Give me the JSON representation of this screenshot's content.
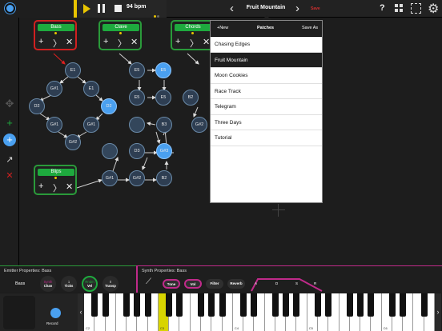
{
  "toolbar": {
    "bpm": "94 bpm",
    "patch_title": "Fruit Mountain",
    "save_label": "Save",
    "help_label": "?"
  },
  "emitters": [
    {
      "label": "Bass",
      "color": "#1eaa3e",
      "border": "#d02020"
    },
    {
      "label": "Clave",
      "color": "#1eaa3e",
      "border": "#2a9a3a"
    },
    {
      "label": "Chords",
      "color": "#1eaa3e",
      "border": "#2a9a3a"
    },
    {
      "label": "Blips",
      "color": "#1eaa3e",
      "border": "#2a9a3a"
    }
  ],
  "emitter_controls": {
    "add": "+",
    "next": "〉",
    "remove": "✕"
  },
  "nodes": [
    {
      "label": "E1"
    },
    {
      "label": "G#1"
    },
    {
      "label": "E1"
    },
    {
      "label": "D2"
    },
    {
      "label": "D2"
    },
    {
      "label": "G#1"
    },
    {
      "label": "G#1"
    },
    {
      "label": "G#2"
    },
    {
      "label": "E5"
    },
    {
      "label": "E5"
    },
    {
      "label": "E5"
    },
    {
      "label": "E5"
    },
    {
      "label": "B2"
    },
    {
      "label": "G#2"
    },
    {
      "label": ""
    },
    {
      "label": "B3"
    },
    {
      "label": ""
    },
    {
      "label": "D3"
    },
    {
      "label": "G#3"
    },
    {
      "label": "G#1"
    },
    {
      "label": "G#2"
    },
    {
      "label": "B2"
    }
  ],
  "patches_popup": {
    "new_label": "+New",
    "title": "Patches",
    "save_as_label": "Save As",
    "items": [
      "Chasing Edges",
      "Fruit Mountain",
      "Moon Cookies",
      "Race Track",
      "Telegram",
      "Three Days",
      "Tutorial"
    ],
    "selected": "Fruit Mountain"
  },
  "emitter_properties": {
    "title": "Emitter Properties: Bass",
    "name": "Bass",
    "knobs": [
      {
        "value": "Synth",
        "label": "Chan"
      },
      {
        "value": "1",
        "label": "Ticks"
      },
      {
        "value": "Rndm",
        "label": "Vel"
      },
      {
        "value": "0",
        "label": "Transp"
      }
    ]
  },
  "synth_properties": {
    "title": "Synth Properties: Bass",
    "controls": [
      "Tone",
      "Vol",
      "Filter",
      "Reverb"
    ],
    "adsr": [
      "A",
      "D",
      "S",
      "R"
    ]
  },
  "record_label": "Record",
  "keyboard": {
    "octave_labels": [
      "C2",
      "C3",
      "C4",
      "C5",
      "C6"
    ]
  },
  "colors": {
    "accent_blue": "#4aa0f0",
    "accent_yellow": "#e8c400",
    "green": "#1eaa3e",
    "magenta": "#c02a8a"
  }
}
